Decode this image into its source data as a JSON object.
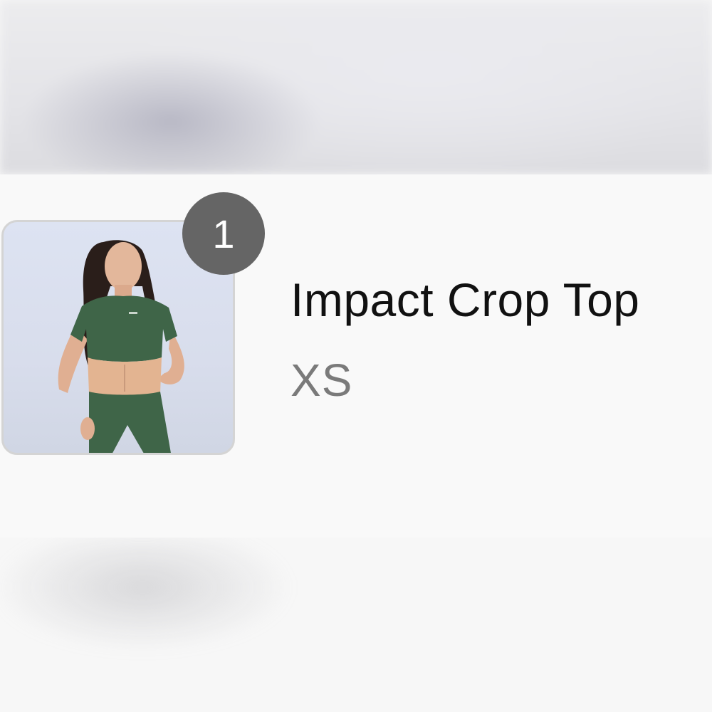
{
  "cart_item": {
    "quantity_badge": "1",
    "product_name": "Impact Crop Top",
    "variant_size": "XS",
    "image_icon": "product-photo"
  },
  "colors": {
    "badge_bg": "#656565",
    "title_text": "#111111",
    "variant_text": "#7a7a7a",
    "card_bg": "#f9f9f9",
    "garment": "#3f6548"
  }
}
